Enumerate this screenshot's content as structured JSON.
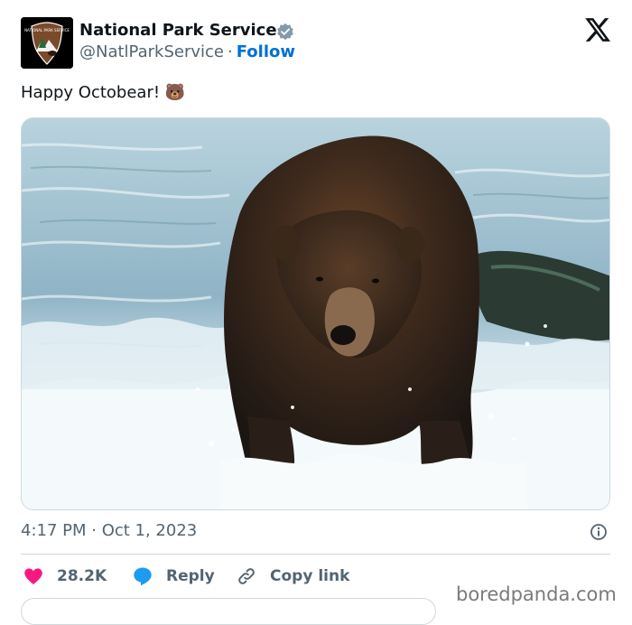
{
  "account": {
    "name": "National Park Service",
    "handle": "@NatlParkService",
    "separator": "·",
    "follow_label": "Follow",
    "avatar_icon": "nps-arrowhead-logo",
    "verified_icon": "verified-badge-icon",
    "avatar_logo_text": "NATIONAL PARK SERVICE"
  },
  "platform_icon": "x-logo-icon",
  "tweet": {
    "text": "Happy Octobear!",
    "emoji": "🐻"
  },
  "media": {
    "icon": "brown-bear-in-river-photo"
  },
  "meta": {
    "timestamp": "4:17 PM · Oct 1, 2023",
    "info_icon": "info-icon"
  },
  "actions": {
    "likes_count": "28.2K",
    "reply_label": "Reply",
    "copy_link_label": "Copy link"
  },
  "watermark": "boredpanda.com",
  "colors": {
    "link_blue": "#006fd6",
    "like_pink": "#f91880",
    "reply_blue": "#1d9bf0",
    "muted": "#536471",
    "text": "#0f1419"
  }
}
